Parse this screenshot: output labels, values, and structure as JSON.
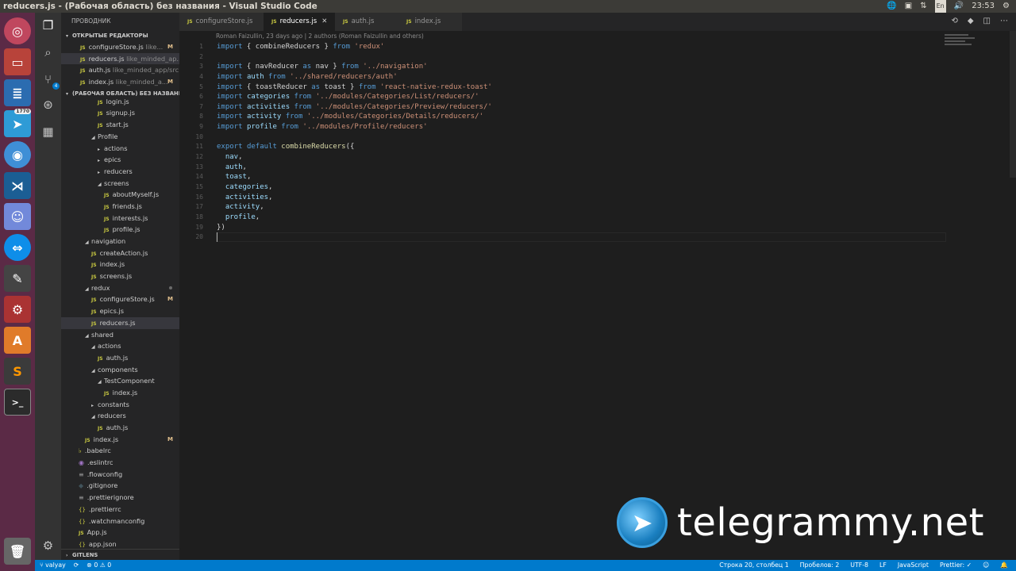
{
  "window": {
    "title": "reducers.js - (Рабочая область) без названия - Visual Studio Code"
  },
  "system_tray": {
    "telegram_badge": "1770",
    "keyboard": "En",
    "time": "23:53",
    "updates_badge": "4"
  },
  "explorer": {
    "header": "ПРОВОДНИК",
    "open_editors_label": "ОТКРЫТЫЕ РЕДАКТОРЫ",
    "open_editors": [
      {
        "name": "configureStore.js",
        "path": "like...",
        "status": "M"
      },
      {
        "name": "reducers.js",
        "path": "like_minded_ap...",
        "status": ""
      },
      {
        "name": "auth.js",
        "path": "like_minded_app/src...",
        "status": ""
      },
      {
        "name": "index.js",
        "path": "like_minded_a...",
        "status": "M"
      }
    ],
    "workspace_label": "(РАБОЧАЯ ОБЛАСТЬ) БЕЗ НАЗВАНИ...",
    "tree": [
      {
        "label": "login.js",
        "type": "js",
        "indent": 5
      },
      {
        "label": "signup.js",
        "type": "js",
        "indent": 5
      },
      {
        "label": "start.js",
        "type": "js",
        "indent": 5
      },
      {
        "label": "Profile",
        "type": "folder-open",
        "indent": 4
      },
      {
        "label": "actions",
        "type": "folder",
        "indent": 5
      },
      {
        "label": "epics",
        "type": "folder",
        "indent": 5
      },
      {
        "label": "reducers",
        "type": "folder",
        "indent": 5
      },
      {
        "label": "screens",
        "type": "folder-open",
        "indent": 5
      },
      {
        "label": "aboutMyself.js",
        "type": "js",
        "indent": 6
      },
      {
        "label": "friends.js",
        "type": "js",
        "indent": 6
      },
      {
        "label": "interests.js",
        "type": "js",
        "indent": 6
      },
      {
        "label": "profile.js",
        "type": "js",
        "indent": 6
      },
      {
        "label": "navigation",
        "type": "folder-open",
        "indent": 3
      },
      {
        "label": "createAction.js",
        "type": "js",
        "indent": 4
      },
      {
        "label": "index.js",
        "type": "js",
        "indent": 4
      },
      {
        "label": "screens.js",
        "type": "js",
        "indent": 4
      },
      {
        "label": "redux",
        "type": "folder-open",
        "indent": 3,
        "dot": true
      },
      {
        "label": "configureStore.js",
        "type": "js",
        "indent": 4,
        "status": "M"
      },
      {
        "label": "epics.js",
        "type": "js",
        "indent": 4
      },
      {
        "label": "reducers.js",
        "type": "js",
        "indent": 4,
        "selected": true
      },
      {
        "label": "shared",
        "type": "folder-open",
        "indent": 3
      },
      {
        "label": "actions",
        "type": "folder-open",
        "indent": 4
      },
      {
        "label": "auth.js",
        "type": "js",
        "indent": 5
      },
      {
        "label": "components",
        "type": "folder-open",
        "indent": 4
      },
      {
        "label": "TestComponent",
        "type": "folder-open",
        "indent": 5
      },
      {
        "label": "index.js",
        "type": "js",
        "indent": 6
      },
      {
        "label": "constants",
        "type": "folder",
        "indent": 4
      },
      {
        "label": "reducers",
        "type": "folder-open",
        "indent": 4
      },
      {
        "label": "auth.js",
        "type": "js",
        "indent": 5
      },
      {
        "label": "index.js",
        "type": "js",
        "indent": 3,
        "status": "M"
      },
      {
        "label": ".babelrc",
        "type": "babel",
        "indent": 2
      },
      {
        "label": ".eslintrc",
        "type": "eslint",
        "indent": 2
      },
      {
        "label": ".flowconfig",
        "type": "config",
        "indent": 2
      },
      {
        "label": ".gitignore",
        "type": "git",
        "indent": 2
      },
      {
        "label": ".prettierignore",
        "type": "config",
        "indent": 2
      },
      {
        "label": ".prettierrc",
        "type": "json",
        "indent": 2
      },
      {
        "label": ".watchmanconfig",
        "type": "json",
        "indent": 2
      },
      {
        "label": "App.js",
        "type": "js",
        "indent": 2
      },
      {
        "label": "app.json",
        "type": "json",
        "indent": 2
      }
    ],
    "gitlens_label": "GITLENS"
  },
  "tabs": [
    {
      "label": "configureStore.js",
      "active": false
    },
    {
      "label": "reducers.js",
      "active": true
    },
    {
      "label": "auth.js",
      "active": false
    },
    {
      "label": "index.js",
      "active": false
    }
  ],
  "editor": {
    "blame": "Roman Faizullin, 23 days ago | 2 authors (Roman Faizullin and others)",
    "lines": [
      "import { combineReducers } from 'redux'",
      "",
      "import { navReducer as nav } from '../navigation'",
      "import auth from '../shared/reducers/auth'",
      "import { toastReducer as toast } from 'react-native-redux-toast'",
      "import categories from '../modules/Categories/List/reducers/'",
      "import activities from '../modules/Categories/Preview/reducers/'",
      "import activity from '../modules/Categories/Details/reducers/'",
      "import profile from '../modules/Profile/reducers'",
      "",
      "export default combineReducers({",
      "  nav,",
      "  auth,",
      "  toast,",
      "  categories,",
      "  activities,",
      "  activity,",
      "  profile,",
      "})",
      ""
    ]
  },
  "status_bar": {
    "branch": "valyay",
    "errors": "0",
    "warnings": "0",
    "position": "Строка 20, столбец 1",
    "spaces": "Пробелов: 2",
    "encoding": "UTF-8",
    "eol": "LF",
    "language": "JavaScript",
    "prettier": "Prettier: ✓"
  },
  "watermark": {
    "text": "telegrammy.net"
  }
}
